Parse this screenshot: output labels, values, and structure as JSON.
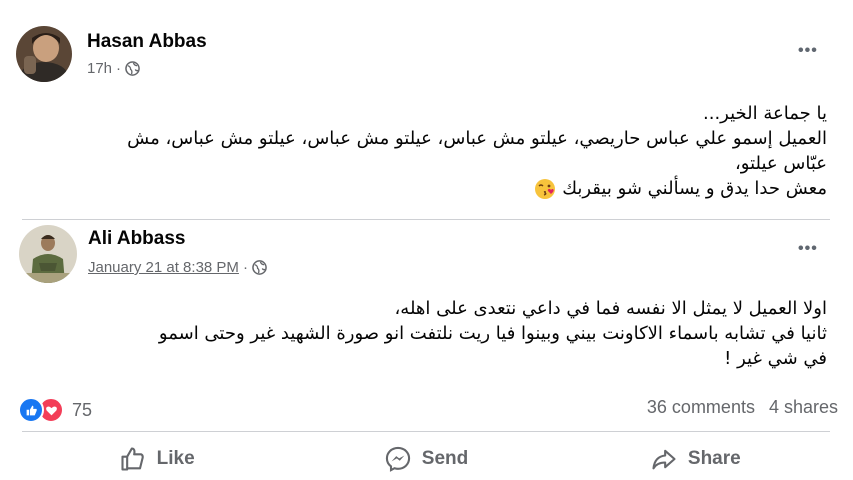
{
  "post": {
    "author": "Hasan Abbas",
    "time": "17h",
    "privacy_icon": "globe-icon",
    "lines": [
      "يا جماعة الخير...",
      "العميل إسمو علي عباس حاريصي، عيلتو مش عباس، عيلتو مش عباس، عيلتو مش عباس، مش",
      "عبّاس عيلتو،",
      "معش حدا يدق و يسألني شو بيقربك"
    ],
    "emoji": "kiss-wink-emoji"
  },
  "shared": {
    "author": "Ali Abbass",
    "time": "January 21 at 8:38 PM",
    "privacy_icon": "globe-icon",
    "lines": [
      "اولا العميل لا يمثل الا نفسه فما في داعي نتعدى على اهله،",
      "ثانيا في تشابه باسماء الاكاونت بيني وبينوا فيا ريت نلتفت انو صورة الشهيد غير وحتى اسمو",
      "في شي غير !"
    ]
  },
  "stats": {
    "reaction_count": "75",
    "comments": "36 comments",
    "shares": "4 shares",
    "reactions": [
      "like",
      "love"
    ]
  },
  "actions": {
    "like": "Like",
    "send": "Send",
    "share": "Share"
  },
  "colors": {
    "like_blue": "#1877f2",
    "love_red": "#f33e58",
    "secondary_text": "#65676b"
  }
}
